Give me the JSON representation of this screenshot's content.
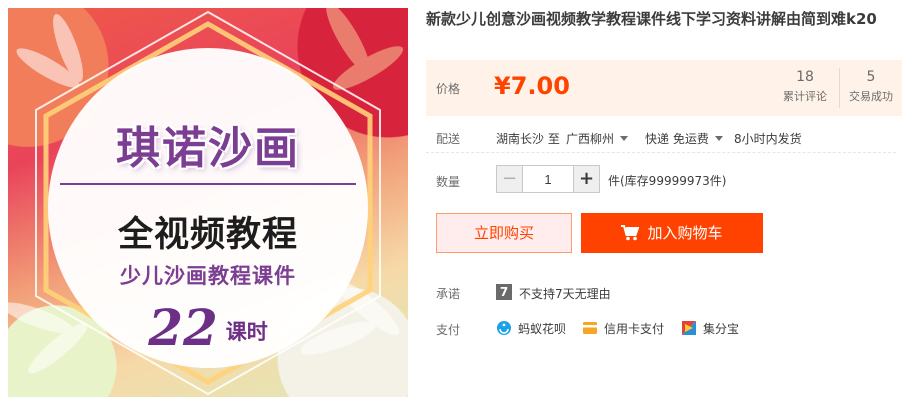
{
  "gallery": {
    "logo_text": "琪诺沙画",
    "headline": "全视频教程",
    "subhead": "少儿沙画教程课件",
    "number": "22",
    "unit": "课时"
  },
  "product": {
    "title": "新款少儿创意沙画视频教学教程课件线下学习资料讲解由简到难k20"
  },
  "price": {
    "label": "价格",
    "value": "¥7.00",
    "reviews_count": "18",
    "reviews_label": "累计评论",
    "deals_count": "5",
    "deals_label": "交易成功"
  },
  "shipping": {
    "label": "配送",
    "from": "湖南长沙 至",
    "to": "广西柳州",
    "method": "快递 免运费",
    "dispatch": "8小时内发货"
  },
  "quantity": {
    "label": "数量",
    "minus": "−",
    "plus": "+",
    "value": "1",
    "stock": "件(库存99999973件)"
  },
  "actions": {
    "buy_now": "立即购买",
    "add_to_cart": "加入购物车"
  },
  "promise": {
    "label": "承诺",
    "icon_text": "7",
    "text": "不支持7天无理由"
  },
  "payment": {
    "label": "支付",
    "methods": [
      {
        "name": "蚂蚁花呗",
        "icon": "huabei-icon",
        "color": "#1aa1e6"
      },
      {
        "name": "信用卡支付",
        "icon": "credit-card-icon",
        "color": "#f5a623"
      },
      {
        "name": "集分宝",
        "icon": "jifenbao-icon",
        "color": "#e0453a"
      }
    ]
  },
  "colors": {
    "accent": "#ff4400",
    "price_bg": "#fff2e8",
    "brand_purple": "#7b3e93"
  }
}
